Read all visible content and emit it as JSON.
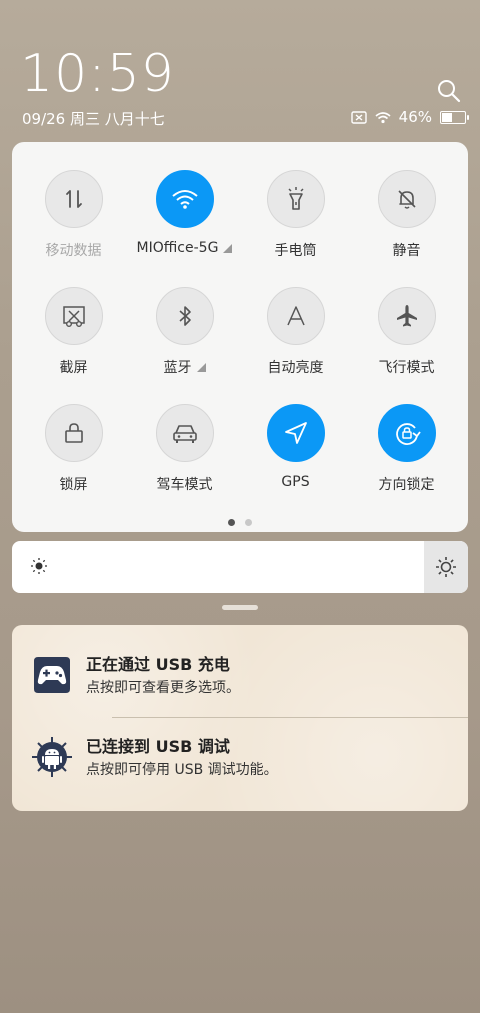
{
  "status": {
    "time": "10:59",
    "date": "09/26  周三  八月十七",
    "battery_percent_text": "46%",
    "battery_level": 0.46
  },
  "tiles": [
    {
      "label": "移动数据",
      "icon": "data-arrows-icon",
      "state": "disabled"
    },
    {
      "label": "MIOffice-5G",
      "icon": "wifi-icon",
      "state": "active"
    },
    {
      "label": "手电筒",
      "icon": "flashlight-icon",
      "state": "off"
    },
    {
      "label": "静音",
      "icon": "bell-mute-icon",
      "state": "off"
    },
    {
      "label": "截屏",
      "icon": "screenshot-icon",
      "state": "off"
    },
    {
      "label": "蓝牙",
      "icon": "bluetooth-icon",
      "state": "off"
    },
    {
      "label": "自动亮度",
      "icon": "auto-brightness-icon",
      "state": "off"
    },
    {
      "label": "飞行模式",
      "icon": "airplane-icon",
      "state": "off"
    },
    {
      "label": "锁屏",
      "icon": "lock-icon",
      "state": "off"
    },
    {
      "label": "驾车模式",
      "icon": "car-icon",
      "state": "off"
    },
    {
      "label": "GPS",
      "icon": "gps-arrow-icon",
      "state": "active"
    },
    {
      "label": "方向锁定",
      "icon": "rotation-lock-icon",
      "state": "active"
    }
  ],
  "brightness": {
    "level": 0.97
  },
  "notifications": [
    {
      "title": "正在通过  USB  充电",
      "text": "点按即可查看更多选项。",
      "icon": "gamepad-icon"
    },
    {
      "title": "已连接到  USB  调试",
      "text": "点按即可停用 USB 调试功能。",
      "icon": "android-icon"
    }
  ],
  "colors": {
    "accent": "#0b98f6"
  }
}
